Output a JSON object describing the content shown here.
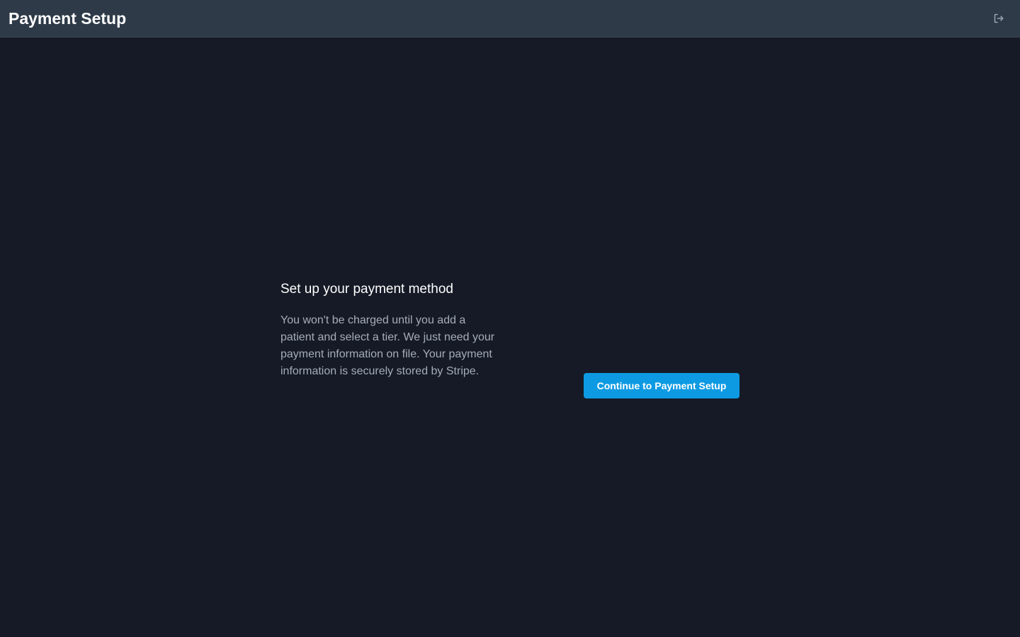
{
  "header": {
    "title": "Payment Setup",
    "logout_icon": "logout-icon"
  },
  "main": {
    "heading": "Set up your payment method",
    "description": "You won't be charged until you add a patient and select a tier. We just need your payment information on file. Your payment information is securely stored by Stripe.",
    "cta_label": "Continue to Payment Setup"
  },
  "colors": {
    "background": "#151a26",
    "header_background": "#2e3a48",
    "accent": "#0d9ae3",
    "heading_text": "#ffffff",
    "body_text": "#a6adb8"
  }
}
